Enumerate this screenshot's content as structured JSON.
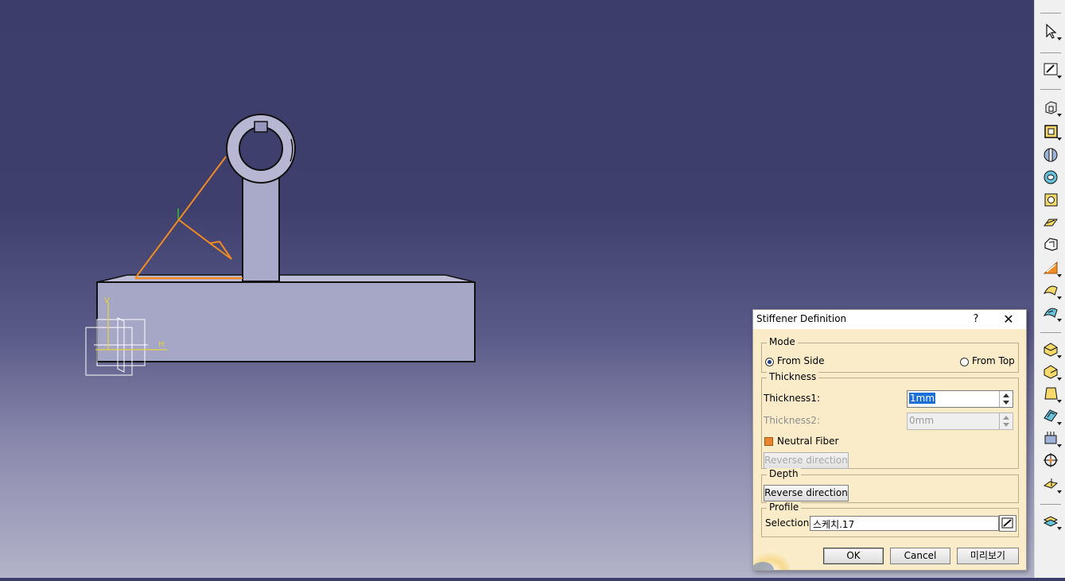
{
  "viewport": {
    "sketch_axis_v": "V",
    "sketch_axis_h": "H"
  },
  "toolbar": {
    "icons": [
      "select-arrow-icon",
      "sketcher-icon",
      "extrude-icon",
      "pocket-icon",
      "shaft-icon",
      "groove-icon",
      "hole-icon",
      "rib-icon",
      "slot-icon",
      "stiffener-icon",
      "multi-section-icon",
      "removed-multi-section-icon",
      "fillet-icon",
      "chamfer-icon",
      "draft-icon",
      "shell-icon",
      "thickness-icon",
      "thread-icon",
      "split-icon",
      "thick-surface-icon"
    ]
  },
  "dialog": {
    "title": "Stiffener Definition",
    "help": "?",
    "close": "✕",
    "mode": {
      "legend": "Mode",
      "from_side": "From Side",
      "from_top": "From Top",
      "selected": "From Side"
    },
    "thickness": {
      "legend": "Thickness",
      "thickness1_label": "Thickness1:",
      "thickness1_value": "1mm",
      "thickness2_label": "Thickness2:",
      "thickness2_value": "0mm",
      "neutral_fiber_label": "Neutral Fiber",
      "neutral_fiber_checked": true,
      "reverse_label": "Reverse direction"
    },
    "depth": {
      "legend": "Depth",
      "reverse_label": "Reverse direction"
    },
    "profile": {
      "legend": "Profile",
      "selection_label": "Selection:",
      "selection_value": "스케치.17"
    },
    "buttons": {
      "ok": "OK",
      "cancel": "Cancel",
      "preview": "미리보기"
    }
  }
}
